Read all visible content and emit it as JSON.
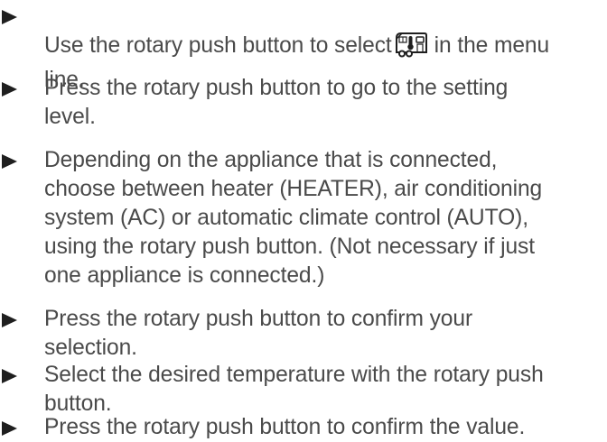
{
  "steps": [
    {
      "text_before_icon": "Use the rotary push button to select",
      "icon": "caravan-climate-icon",
      "text_after_icon": "in the menu",
      "text_line2": "line."
    },
    {
      "text": "Press the rotary push button to go to the setting\nlevel."
    },
    {
      "text": "Depending on the appliance that is connected,\nchoose between heater (HEATER), air conditioning\nsystem (AC) or automatic climate control (AUTO),\nusing the rotary push button. (Not necessary if just\none appliance is connected.)"
    },
    {
      "text": "Press the rotary push button to confirm your\nselection."
    },
    {
      "text": "Select the desired temperature with the rotary push\nbutton."
    },
    {
      "text": "Press the rotary push button to confirm the value."
    }
  ],
  "colors": {
    "text": "#4a4a4a",
    "bullet": "#1f1f1f"
  }
}
